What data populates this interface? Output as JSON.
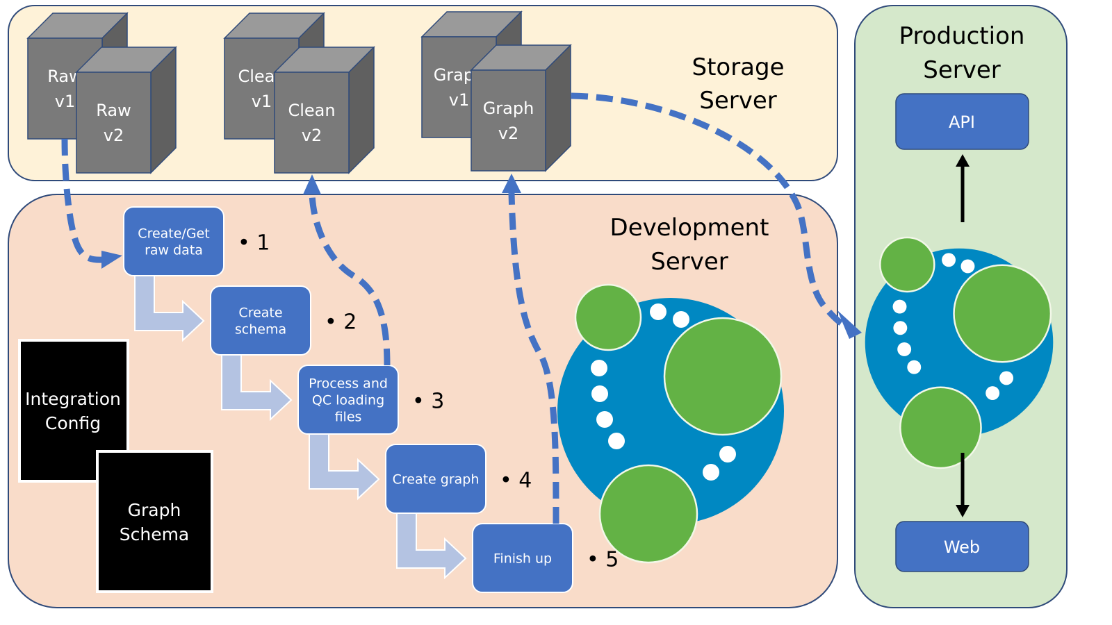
{
  "colors": {
    "storage_bg": "#fef2d8",
    "development_bg": "#f9dcc9",
    "production_bg": "#d5e8cb",
    "panel_border": "#2f4a7a",
    "step_box": "#4472c4",
    "step_arrow": "#b4c3e2",
    "dashed_flow": "#4472c4",
    "cube_front": "#7a7a7a",
    "cube_top": "#9a9a9a",
    "cube_side": "#606060",
    "document_bg": "#000000",
    "neo4j_blue": "#0088c2",
    "neo4j_green": "#63b245"
  },
  "storage_server": {
    "title_line1": "Storage",
    "title_line2": "Server",
    "cubes": [
      {
        "line1": "Raw",
        "line2": "v1"
      },
      {
        "line1": "Raw",
        "line2": "v2"
      },
      {
        "line1": "Clean",
        "line2": "v1"
      },
      {
        "line1": "Clean",
        "line2": "v2"
      },
      {
        "line1": "Graph",
        "line2": "v1"
      },
      {
        "line1": "Graph",
        "line2": "v2"
      }
    ]
  },
  "development_server": {
    "title_line1": "Development",
    "title_line2": "Server",
    "steps": [
      {
        "lines": [
          "Create/Get",
          "raw data"
        ],
        "number": "• 1"
      },
      {
        "lines": [
          "Create",
          "schema"
        ],
        "number": "• 2"
      },
      {
        "lines": [
          "Process and",
          "QC loading",
          "files"
        ],
        "number": "• 3"
      },
      {
        "lines": [
          "Create graph"
        ],
        "number": "• 4"
      },
      {
        "lines": [
          "Finish up"
        ],
        "number": "• 5"
      }
    ],
    "documents": [
      {
        "line1": "Integration",
        "line2": "Config"
      },
      {
        "line1": "Graph",
        "line2": "Schema"
      }
    ],
    "logo": "neo4j-logo"
  },
  "production_server": {
    "title_line1": "Production",
    "title_line2": "Server",
    "api_label": "API",
    "web_label": "Web",
    "logo": "neo4j-logo"
  }
}
